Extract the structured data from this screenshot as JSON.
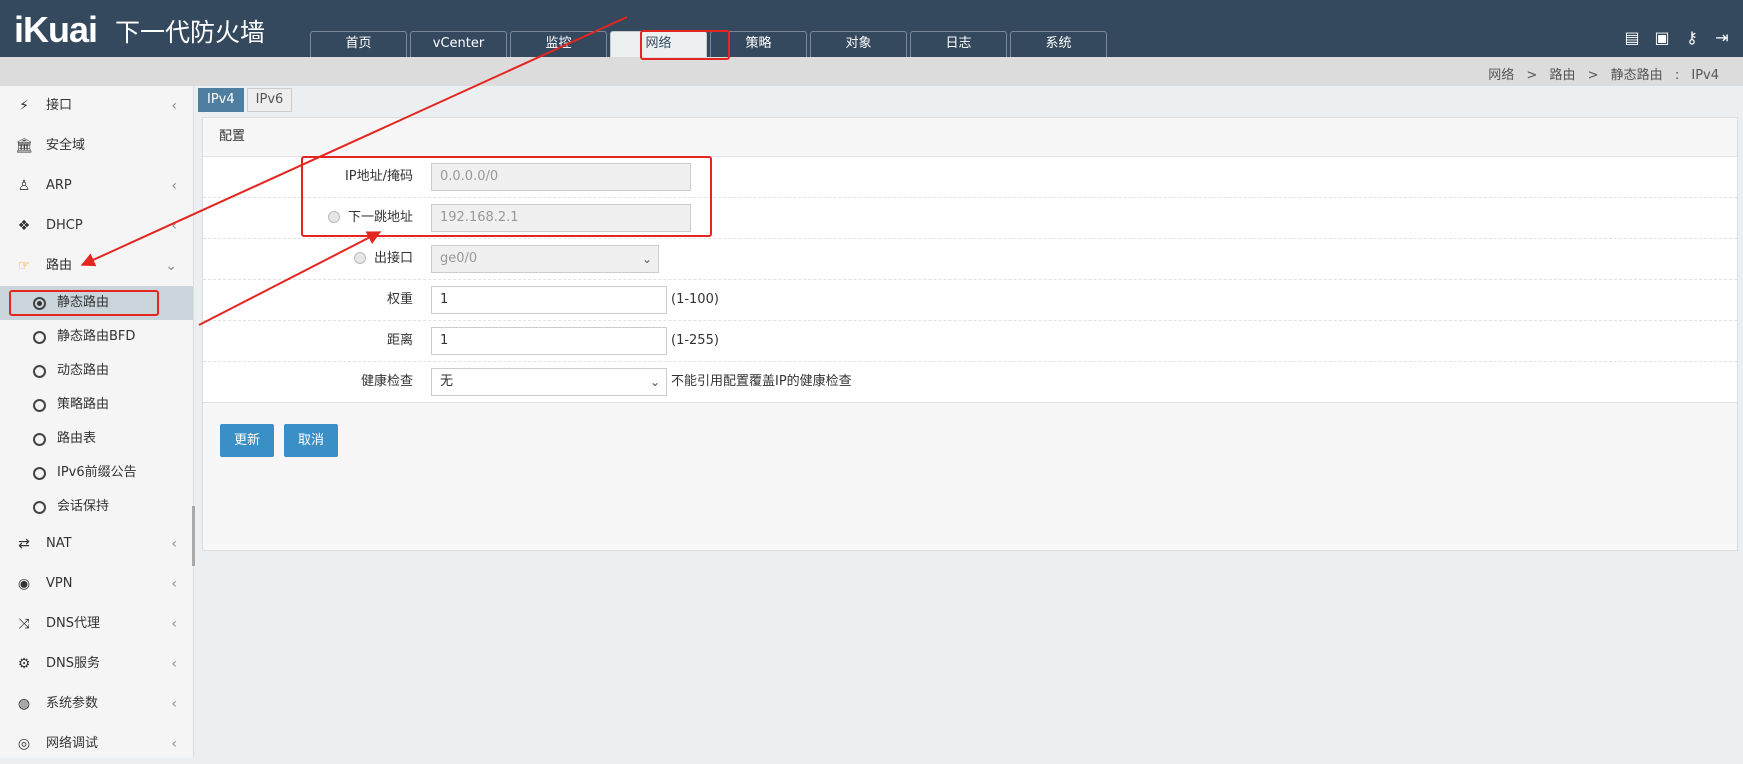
{
  "header": {
    "logo": "iKuai",
    "product": "下一代防火墙",
    "tabs": [
      {
        "label": "首页"
      },
      {
        "label": "vCenter"
      },
      {
        "label": "监控"
      },
      {
        "label": "网络"
      },
      {
        "label": "策略"
      },
      {
        "label": "对象"
      },
      {
        "label": "日志"
      },
      {
        "label": "系统"
      }
    ],
    "active_tab": "网络"
  },
  "breadcrumb": {
    "items": [
      "网络",
      "路由",
      "静态路由"
    ],
    "separator": ">",
    "colon": ":",
    "current": "IPv4"
  },
  "sidebar": {
    "items": [
      {
        "label": "接口",
        "icon": "plug-icon"
      },
      {
        "label": "安全域",
        "icon": "bank-icon"
      },
      {
        "label": "ARP",
        "icon": "person-icon"
      },
      {
        "label": "DHCP",
        "icon": "cubes-icon"
      },
      {
        "label": "路由",
        "icon": "hand-pointer-icon"
      },
      {
        "label": "NAT",
        "icon": "exchange-icon"
      },
      {
        "label": "VPN",
        "icon": "lock-icon"
      },
      {
        "label": "DNS代理",
        "icon": "shuffle-icon"
      },
      {
        "label": "DNS服务",
        "icon": "gears-icon"
      },
      {
        "label": "系统参数",
        "icon": "globe-icon"
      },
      {
        "label": "网络调试",
        "icon": "target-icon"
      }
    ],
    "route_sub": [
      {
        "label": "静态路由"
      },
      {
        "label": "静态路由BFD"
      },
      {
        "label": "动态路由"
      },
      {
        "label": "策略路由"
      },
      {
        "label": "路由表"
      },
      {
        "label": "IPv6前缀公告"
      },
      {
        "label": "会话保持"
      }
    ],
    "active_sub": "静态路由"
  },
  "content": {
    "tabs": [
      "IPv4",
      "IPv6"
    ],
    "panel_title": "配置",
    "form": {
      "ip_mask_label": "IP地址/掩码",
      "ip_mask_value": "0.0.0.0/0",
      "next_hop_label": "下一跳地址",
      "next_hop_value": "192.168.2.1",
      "out_if_label": "出接口",
      "out_if_value": "ge0/0",
      "weight_label": "权重",
      "weight_value": "1",
      "weight_hint": "(1-100)",
      "distance_label": "距离",
      "distance_value": "1",
      "distance_hint": "(1-255)",
      "health_label": "健康检查",
      "health_value": "无",
      "health_hint": "不能引用配置覆盖IP的健康检查"
    },
    "buttons": {
      "update": "更新",
      "cancel": "取消"
    }
  },
  "colors": {
    "header_bg": "#34495e",
    "accent": "#3a8fc7",
    "annotation": "#e3261f"
  }
}
